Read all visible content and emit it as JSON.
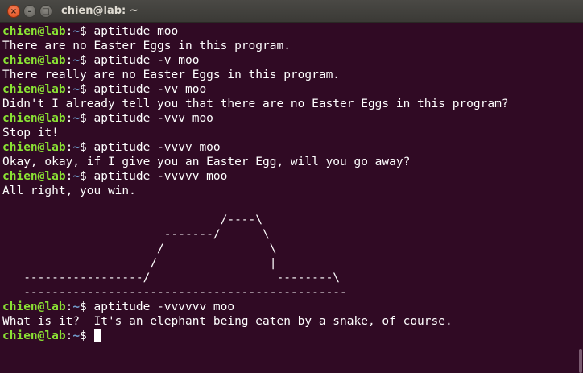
{
  "window": {
    "title": "chien@lab: ~",
    "close_glyph": "×",
    "minimize_glyph": "–",
    "maximize_glyph": "□"
  },
  "colors": {
    "background": "#300a24",
    "text": "#ffffff",
    "prompt_user": "#8ae234",
    "prompt_path": "#729fcf"
  },
  "prompt": {
    "user": "chien@lab",
    "separator": ":",
    "path": "~",
    "symbol": "$"
  },
  "session": [
    {
      "type": "command",
      "text": " aptitude moo"
    },
    {
      "type": "output",
      "text": "There are no Easter Eggs in this program."
    },
    {
      "type": "command",
      "text": " aptitude -v moo"
    },
    {
      "type": "output",
      "text": "There really are no Easter Eggs in this program."
    },
    {
      "type": "command",
      "text": " aptitude -vv moo"
    },
    {
      "type": "output",
      "text": "Didn't I already tell you that there are no Easter Eggs in this program?"
    },
    {
      "type": "command",
      "text": " aptitude -vvv moo"
    },
    {
      "type": "output",
      "text": "Stop it!"
    },
    {
      "type": "command",
      "text": " aptitude -vvvv moo"
    },
    {
      "type": "output",
      "text": "Okay, okay, if I give you an Easter Egg, will you go away?"
    },
    {
      "type": "command",
      "text": " aptitude -vvvvv moo"
    },
    {
      "type": "output",
      "text": "All right, you win."
    },
    {
      "type": "output",
      "text": ""
    },
    {
      "type": "output",
      "text": "                               /----\\"
    },
    {
      "type": "output",
      "text": "                       -------/      \\"
    },
    {
      "type": "output",
      "text": "                      /               \\"
    },
    {
      "type": "output",
      "text": "                     /                |"
    },
    {
      "type": "output",
      "text": "   -----------------/                  --------\\"
    },
    {
      "type": "output",
      "text": "   ----------------------------------------------"
    },
    {
      "type": "command",
      "text": " aptitude -vvvvvv moo"
    },
    {
      "type": "output",
      "text": "What is it?  It's an elephant being eaten by a snake, of course."
    },
    {
      "type": "command",
      "text": " ",
      "cursor": true
    }
  ]
}
